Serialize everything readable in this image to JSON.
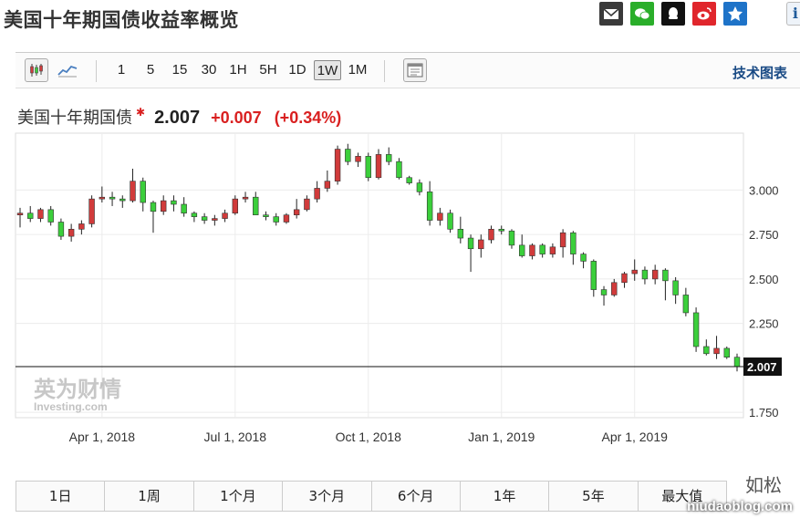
{
  "page": {
    "title": "美国十年期国债收益率概览"
  },
  "share_icons": [
    {
      "name": "mail-icon",
      "color": "#3a3a3a"
    },
    {
      "name": "wechat-icon",
      "color": "#2aae2a"
    },
    {
      "name": "qq-icon",
      "color": "#111111"
    },
    {
      "name": "weibo-icon",
      "color": "#e0262c"
    },
    {
      "name": "qzone-icon",
      "color": "#1e73c8"
    }
  ],
  "toolbar": {
    "chart_types": [
      "candlestick-icon",
      "line-chart-icon"
    ],
    "timeframes": [
      "1",
      "5",
      "15",
      "30",
      "1H",
      "5H",
      "1D",
      "1W",
      "1M"
    ],
    "active_timeframe": "1W",
    "tech_chart_link": "技术图表"
  },
  "quote": {
    "name": "美国十年期国债",
    "price": "2.007",
    "change": "+0.007",
    "change_pct": "(+0.34%)",
    "up_color": "#d92020"
  },
  "chart_data": {
    "type": "candlestick",
    "x_ticks": [
      "Apr 1, 2018",
      "Jul 1, 2018",
      "Oct 1, 2018",
      "Jan 1, 2019",
      "Apr 1, 2019"
    ],
    "x_tick_weeks": [
      8,
      21,
      34,
      47,
      60
    ],
    "y_ticks": [
      "3.000",
      "2.750",
      "2.500",
      "2.250",
      "1.750"
    ],
    "y_tick_values": [
      3.0,
      2.75,
      2.5,
      2.25,
      1.75
    ],
    "ylim": [
      1.72,
      3.32
    ],
    "last_price_label": "2.007",
    "last_price": 2.007,
    "up_color": "#d13b3b",
    "down_color": "#3bcf3b",
    "candles": [
      [
        2.86,
        2.9,
        2.79,
        2.87
      ],
      [
        2.87,
        2.91,
        2.82,
        2.84
      ],
      [
        2.84,
        2.9,
        2.82,
        2.89
      ],
      [
        2.89,
        2.91,
        2.8,
        2.82
      ],
      [
        2.82,
        2.84,
        2.72,
        2.74
      ],
      [
        2.74,
        2.81,
        2.71,
        2.78
      ],
      [
        2.78,
        2.83,
        2.75,
        2.81
      ],
      [
        2.81,
        2.97,
        2.79,
        2.95
      ],
      [
        2.95,
        3.02,
        2.93,
        2.96
      ],
      [
        2.96,
        2.99,
        2.91,
        2.95
      ],
      [
        2.95,
        2.97,
        2.9,
        2.94
      ],
      [
        2.94,
        3.12,
        2.93,
        3.05
      ],
      [
        3.05,
        3.07,
        2.88,
        2.93
      ],
      [
        2.93,
        2.94,
        2.76,
        2.88
      ],
      [
        2.88,
        2.97,
        2.86,
        2.94
      ],
      [
        2.94,
        2.97,
        2.88,
        2.92
      ],
      [
        2.92,
        2.96,
        2.85,
        2.87
      ],
      [
        2.87,
        2.88,
        2.82,
        2.85
      ],
      [
        2.85,
        2.87,
        2.81,
        2.83
      ],
      [
        2.83,
        2.86,
        2.8,
        2.84
      ],
      [
        2.84,
        2.89,
        2.82,
        2.87
      ],
      [
        2.87,
        2.97,
        2.86,
        2.95
      ],
      [
        2.95,
        2.99,
        2.93,
        2.96
      ],
      [
        2.96,
        2.99,
        2.91,
        2.86
      ],
      [
        2.86,
        2.88,
        2.83,
        2.85
      ],
      [
        2.85,
        2.87,
        2.8,
        2.82
      ],
      [
        2.82,
        2.87,
        2.81,
        2.86
      ],
      [
        2.86,
        2.95,
        2.84,
        2.89
      ],
      [
        2.89,
        2.97,
        2.88,
        2.95
      ],
      [
        2.95,
        3.05,
        2.93,
        3.01
      ],
      [
        3.01,
        3.11,
        2.99,
        3.05
      ],
      [
        3.05,
        3.25,
        3.03,
        3.23
      ],
      [
        3.23,
        3.26,
        3.14,
        3.16
      ],
      [
        3.16,
        3.21,
        3.13,
        3.19
      ],
      [
        3.19,
        3.21,
        3.05,
        3.07
      ],
      [
        3.07,
        3.23,
        3.06,
        3.2
      ],
      [
        3.2,
        3.24,
        3.14,
        3.16
      ],
      [
        3.16,
        3.18,
        3.06,
        3.07
      ],
      [
        3.07,
        3.08,
        3.03,
        3.04
      ],
      [
        3.04,
        3.06,
        2.97,
        2.99
      ],
      [
        2.99,
        3.05,
        2.8,
        2.83
      ],
      [
        2.83,
        2.9,
        2.8,
        2.87
      ],
      [
        2.87,
        2.89,
        2.76,
        2.78
      ],
      [
        2.78,
        2.85,
        2.7,
        2.73
      ],
      [
        2.73,
        2.75,
        2.54,
        2.67
      ],
      [
        2.67,
        2.75,
        2.62,
        2.72
      ],
      [
        2.72,
        2.8,
        2.7,
        2.78
      ],
      [
        2.78,
        2.8,
        2.75,
        2.77
      ],
      [
        2.77,
        2.78,
        2.67,
        2.69
      ],
      [
        2.69,
        2.75,
        2.62,
        2.63
      ],
      [
        2.63,
        2.7,
        2.61,
        2.69
      ],
      [
        2.69,
        2.7,
        2.62,
        2.64
      ],
      [
        2.64,
        2.7,
        2.62,
        2.68
      ],
      [
        2.68,
        2.78,
        2.62,
        2.76
      ],
      [
        2.76,
        2.77,
        2.58,
        2.64
      ],
      [
        2.64,
        2.65,
        2.56,
        2.6
      ],
      [
        2.6,
        2.61,
        2.4,
        2.44
      ],
      [
        2.44,
        2.46,
        2.35,
        2.41
      ],
      [
        2.41,
        2.5,
        2.4,
        2.48
      ],
      [
        2.48,
        2.54,
        2.45,
        2.53
      ],
      [
        2.53,
        2.61,
        2.49,
        2.55
      ],
      [
        2.55,
        2.57,
        2.47,
        2.5
      ],
      [
        2.5,
        2.58,
        2.47,
        2.55
      ],
      [
        2.55,
        2.56,
        2.38,
        2.49
      ],
      [
        2.49,
        2.51,
        2.36,
        2.41
      ],
      [
        2.41,
        2.45,
        2.29,
        2.31
      ],
      [
        2.31,
        2.34,
        2.09,
        2.12
      ],
      [
        2.12,
        2.16,
        2.07,
        2.08
      ],
      [
        2.08,
        2.18,
        2.05,
        2.11
      ],
      [
        2.11,
        2.12,
        2.05,
        2.06
      ],
      [
        2.06,
        2.08,
        1.98,
        2.007
      ]
    ],
    "watermark_brand": "英为财情",
    "watermark_sub": "Investing.com"
  },
  "periods": [
    "1日",
    "1周",
    "1个月",
    "3个月",
    "6个月",
    "1年",
    "5年",
    "最大值"
  ],
  "watermark": {
    "cn": "如松",
    "site": "niudaoblog.com"
  }
}
